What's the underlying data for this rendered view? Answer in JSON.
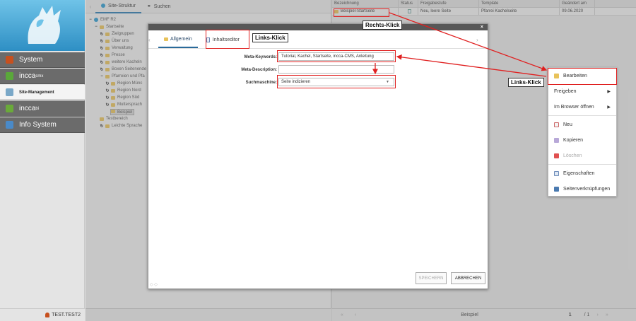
{
  "left_nav": {
    "items": [
      {
        "label": "System",
        "sup": ""
      },
      {
        "label": "incca",
        "sup": "cmx"
      },
      {
        "label": "Site-Management",
        "sup": ""
      },
      {
        "label": "incca",
        "sup": "bi"
      },
      {
        "label": "Info System",
        "sup": ""
      }
    ],
    "user": "TEST.TEST2"
  },
  "tree_panel": {
    "tabs": [
      "Site-Struktur",
      "Suchen"
    ],
    "nodes": [
      {
        "label": "EMF R2"
      },
      {
        "label": "Startseite"
      },
      {
        "label": "Zielgruppen"
      },
      {
        "label": "Über uns"
      },
      {
        "label": "Verwaltung"
      },
      {
        "label": "Presse"
      },
      {
        "label": "weitere Kacheln"
      },
      {
        "label": "Boxen Seitenende"
      },
      {
        "label": "Pfarreien und Pfa"
      },
      {
        "label": "Region Münc"
      },
      {
        "label": "Region Nord"
      },
      {
        "label": "Region Süd"
      },
      {
        "label": "Muttersprach"
      },
      {
        "label": "Beispiel"
      },
      {
        "label": "Testbereich"
      },
      {
        "label": "Leichte Sprache"
      }
    ]
  },
  "list": {
    "headers": [
      "Bezeichnung",
      "Status",
      "Freigabestufe",
      "Template",
      "Geändert am"
    ],
    "rows": [
      {
        "name": "Beispiel-Startseite",
        "status": "",
        "freigabe": "Neu, leere Seite",
        "template": "Pfarrei Kachelseite",
        "date": "09.06.2020"
      }
    ],
    "footer": {
      "title": "Beispiel",
      "page": "1",
      "total": "/ 1"
    }
  },
  "dialog": {
    "tabs": [
      "Allgemein",
      "Inhaltseditor"
    ],
    "fields": {
      "meta_keywords_label": "Meta-Keywords:",
      "meta_keywords_value": "Tutorial, Kachel, Startseite, incca-CMS, Anleitung",
      "meta_description_label": "Meta-Description:",
      "meta_description_value": "",
      "suchmaschine_label": "Suchmaschine:",
      "suchmaschine_value": "Seite indizieren"
    },
    "buttons": {
      "save": "SPEICHERN",
      "cancel": "ABBRECHEN"
    },
    "close": "×"
  },
  "context_menu": {
    "items": [
      {
        "label": "Bearbeiten",
        "submenu": false,
        "disabled": false
      },
      {
        "label": "Freigeben",
        "submenu": true,
        "disabled": false
      },
      {
        "label": "Im Browser öffnen",
        "submenu": true,
        "disabled": false
      },
      {
        "label": "Neu",
        "submenu": false,
        "disabled": false
      },
      {
        "label": "Kopieren",
        "submenu": false,
        "disabled": false
      },
      {
        "label": "Löschen",
        "submenu": false,
        "disabled": true
      },
      {
        "label": "Eigenschaften",
        "submenu": false,
        "disabled": false
      },
      {
        "label": "Seitenverknüpfungen",
        "submenu": false,
        "disabled": false
      }
    ]
  },
  "annotations": {
    "rechts_klick": "Rechts-Klick",
    "links_klick_editor": "Links-Klick",
    "links_klick_menu": "Links-Klick"
  },
  "colors": {
    "annotation_red": "#e02020",
    "accent_blue": "#2a7ab0",
    "folder": "#e8c25a"
  }
}
